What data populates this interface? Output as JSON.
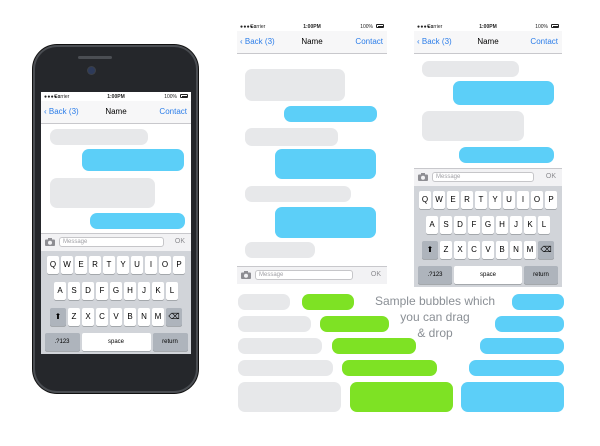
{
  "status": {
    "carrier": "Carrier",
    "time": "1:00PM",
    "battery": "100%"
  },
  "nav": {
    "back_label": "Back (3)",
    "title": "Name",
    "contact_label": "Contact"
  },
  "input": {
    "placeholder": "Message",
    "ok_label": "OK"
  },
  "keyboard": {
    "row1": [
      "Q",
      "W",
      "E",
      "R",
      "T",
      "Y",
      "U",
      "I",
      "O",
      "P"
    ],
    "row2": [
      "A",
      "S",
      "D",
      "F",
      "G",
      "H",
      "J",
      "K",
      "L"
    ],
    "row3": [
      "Z",
      "X",
      "C",
      "V",
      "B",
      "N",
      "M"
    ],
    "shift_glyph": "⬆",
    "delete_glyph": "⌫",
    "numbers_label": ".?123",
    "space_label": "space",
    "return_label": "return"
  },
  "caption": {
    "line1": "Sample bubbles which",
    "line2": "you can drag",
    "line3": "& drop"
  },
  "colors": {
    "incoming": "#e7e8ea",
    "outgoing": "#5ccff8",
    "sms": "#7ee224",
    "link": "#2b7de9"
  }
}
